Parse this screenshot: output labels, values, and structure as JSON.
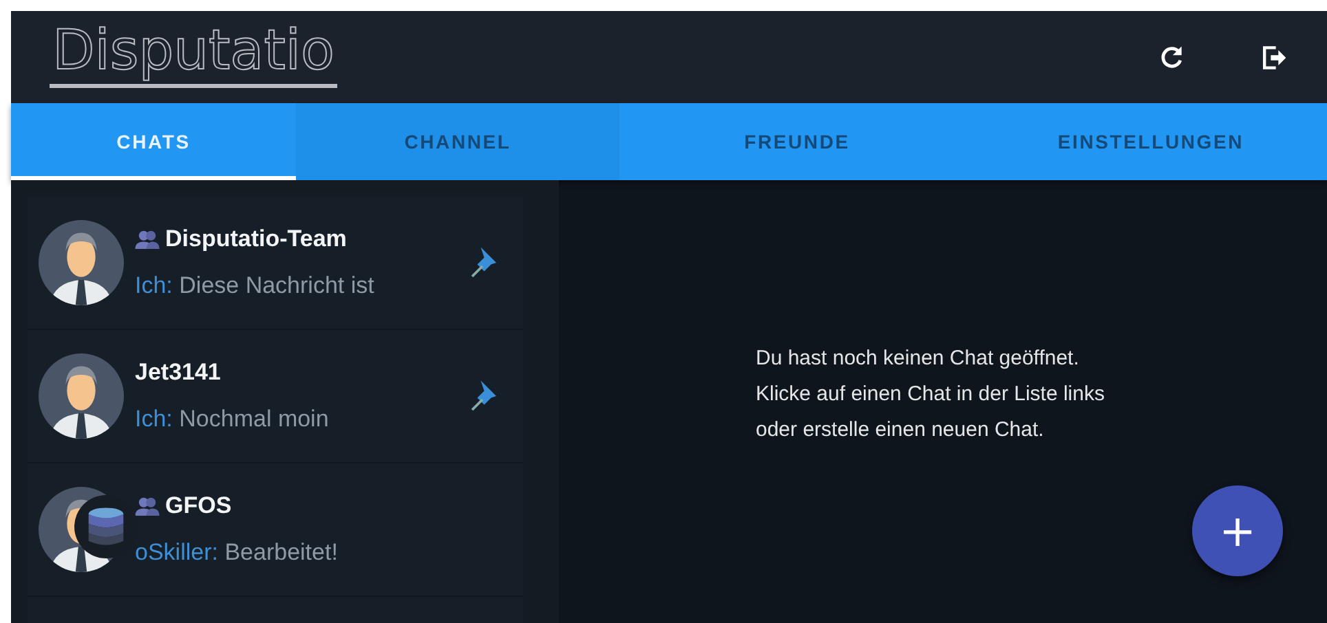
{
  "header": {
    "logo": "Disputatio"
  },
  "tabs": [
    {
      "label": "CHATS",
      "selected": true
    },
    {
      "label": "CHANNEL",
      "selected": false
    },
    {
      "label": "FREUNDE",
      "selected": false
    },
    {
      "label": "EINSTELLUNGEN",
      "selected": false
    }
  ],
  "chats": [
    {
      "name": "Disputatio-Team",
      "group": true,
      "sender": "Ich:",
      "message": "Diese Nachricht ist",
      "pinned": true
    },
    {
      "name": "Jet3141",
      "group": false,
      "sender": "Ich:",
      "message": "Nochmal moin",
      "pinned": true
    },
    {
      "name": "GFOS",
      "group": true,
      "sender": "oSkiller:",
      "message": "Bearbeitet!",
      "pinned": false
    }
  ],
  "empty_state": {
    "lines": [
      "Du hast noch keinen Chat geöffnet.",
      "Klicke auf einen Chat in der Liste links",
      "oder erstelle einen neuen Chat."
    ]
  },
  "fab": {
    "label": "+"
  }
}
